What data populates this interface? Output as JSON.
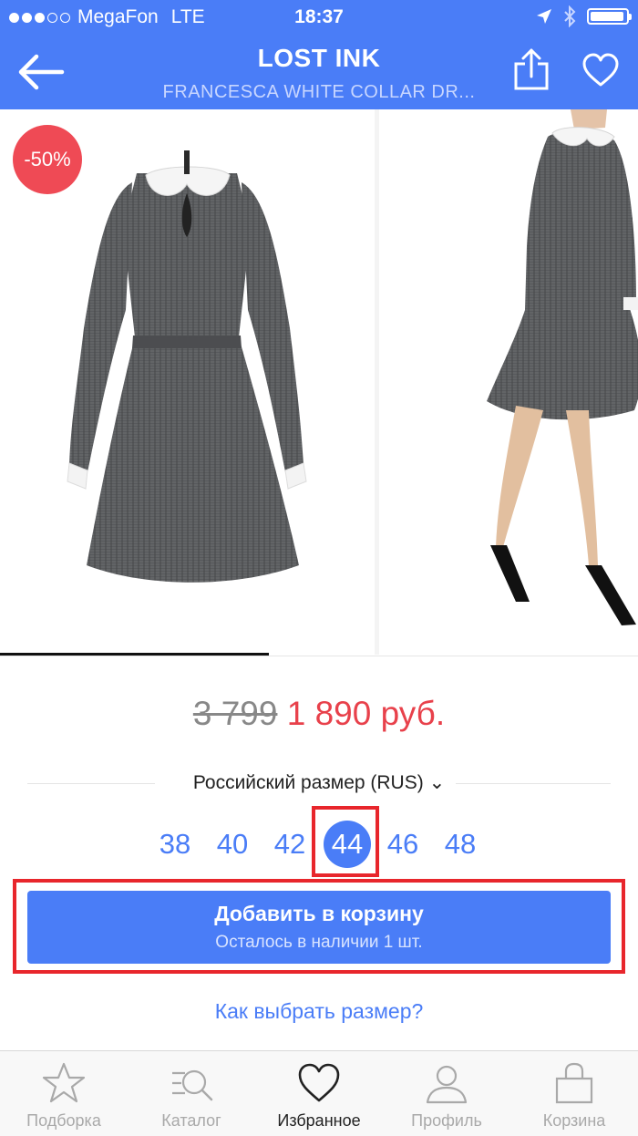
{
  "status_bar": {
    "carrier": "MegaFon",
    "network": "LTE",
    "time": "18:37",
    "signal_filled": 3,
    "signal_total": 5,
    "battery_level": 0.95
  },
  "header": {
    "title": "LOST INK",
    "subtitle": "FRANCESCA WHITE COLLAR DR...",
    "back_icon": "back-arrow-icon",
    "share_icon": "share-icon",
    "favorite_icon": "heart-icon"
  },
  "gallery": {
    "discount_badge": "-50%",
    "active_index": 1,
    "image_count": 2
  },
  "price": {
    "old": "3 799",
    "new": "1 890 руб."
  },
  "size_selector": {
    "label": "Российский размер (RUS)",
    "chevron": "⌄",
    "sizes": [
      "38",
      "40",
      "42",
      "44",
      "46",
      "48"
    ],
    "selected": "44"
  },
  "add_to_cart": {
    "label": "Добавить в корзину",
    "stock_note": "Осталось в наличии 1 шт."
  },
  "size_help_link": "Как выбрать размер?",
  "tabbar": {
    "items": [
      {
        "label": "Подборка",
        "icon": "star-icon"
      },
      {
        "label": "Каталог",
        "icon": "catalog-search-icon"
      },
      {
        "label": "Избранное",
        "icon": "heart-icon"
      },
      {
        "label": "Профиль",
        "icon": "person-icon"
      },
      {
        "label": "Корзина",
        "icon": "bag-icon"
      }
    ],
    "active": 2
  },
  "colors": {
    "accent": "#4a7df7",
    "sale_red": "#e8414b",
    "highlight_red": "#e8262c"
  }
}
